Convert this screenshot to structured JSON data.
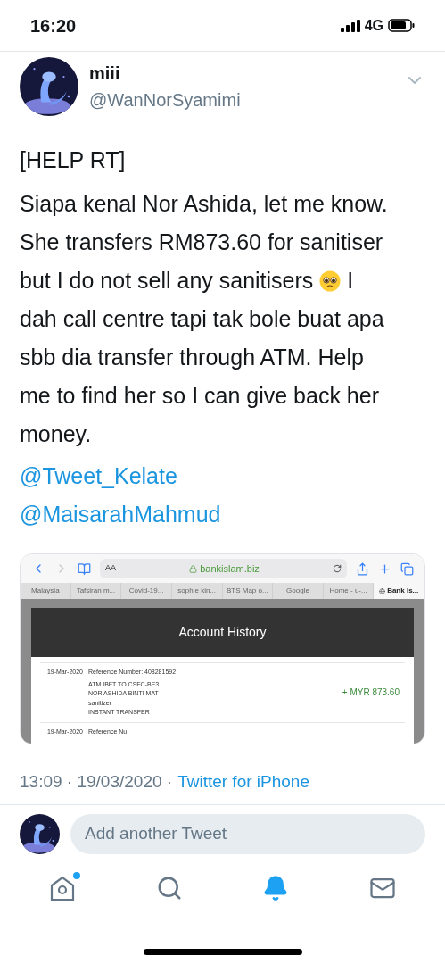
{
  "status_bar": {
    "time": "16:20",
    "network": "4G"
  },
  "tweet": {
    "name": "miii",
    "handle": "@WanNorSyamimi",
    "lines": [
      "[HELP RT]"
    ],
    "body_lines": [
      {
        "text": "Siapa kenal Nor Ashida, let me know.",
        "emoji": false
      },
      {
        "text": "She transfers RM873.60 for sanitiser",
        "emoji": false
      },
      {
        "text": "but I do not sell any sanitisers",
        "emoji": true,
        "after": "I"
      },
      {
        "text": "dah call centre tapi tak bole buat apa",
        "emoji": false
      },
      {
        "text": "sbb dia transfer through ATM. Help",
        "emoji": false
      },
      {
        "text": "me to find her so I can give back her",
        "emoji": false
      },
      {
        "text": "money.",
        "emoji": false
      }
    ],
    "mentions": [
      "@Tweet_Kelate",
      "@MaisarahMahmud"
    ],
    "time": "13:09 · 19/03/2020 ·",
    "source": "Twitter for iPhone"
  },
  "screenshot": {
    "reader_button": "AA",
    "url": "bankislam.biz",
    "tabs": [
      {
        "label": "Malaysia",
        "selected": false
      },
      {
        "label": "Tafsiran m...",
        "selected": false
      },
      {
        "label": "Covid-19...",
        "selected": false
      },
      {
        "label": "sophie kin...",
        "selected": false
      },
      {
        "label": "BTS Map o...",
        "selected": false
      },
      {
        "label": "Google",
        "selected": false
      },
      {
        "label": "Home - u-...",
        "selected": false
      },
      {
        "label": "Bank Is...",
        "selected": true
      }
    ],
    "title": "Account History",
    "rows": [
      {
        "date": "19-Mar-2020",
        "reference": "Reference Number: 408281592",
        "details": [
          "ATM IBFT TO CSFC-BE3",
          "NOR ASHIDA BINTI MAT",
          "sanitizer",
          "INSTANT TRANSFER"
        ],
        "amount": "+ MYR 873.60"
      },
      {
        "date": "19-Mar-2020",
        "reference": "Reference Nu",
        "details": []
      }
    ]
  },
  "reply": {
    "placeholder": "Add another Tweet"
  },
  "tab_bar": [
    {
      "kind": "home",
      "selected": false,
      "badge": true
    },
    {
      "kind": "search",
      "selected": false,
      "badge": false
    },
    {
      "kind": "notifications",
      "selected": true,
      "badge": false
    },
    {
      "kind": "messages",
      "selected": false,
      "badge": false
    }
  ]
}
